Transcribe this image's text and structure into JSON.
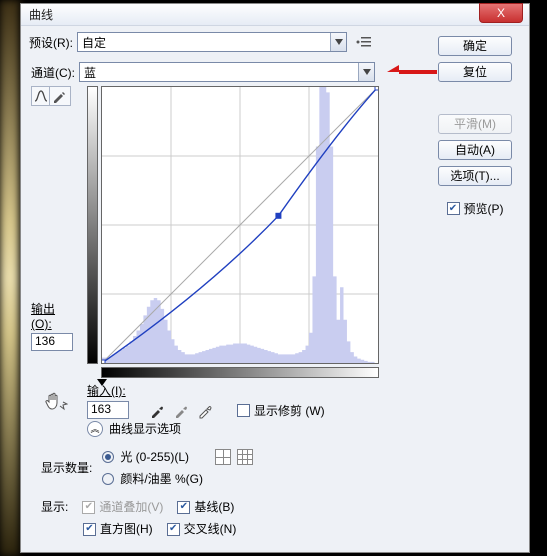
{
  "window": {
    "title": "曲线"
  },
  "preset": {
    "label": "预设(R):",
    "value": "自定"
  },
  "buttons": {
    "ok": "确定",
    "reset": "复位",
    "smooth": "平滑(M)",
    "auto": "自动(A)",
    "options": "选项(T)..."
  },
  "preview": {
    "label": "预览(P)",
    "checked": true
  },
  "channel": {
    "label": "通道(C):",
    "value": "蓝"
  },
  "output": {
    "label": "输出(O):",
    "value": "136"
  },
  "input": {
    "label": "输入(I):",
    "value": "163"
  },
  "showclip": {
    "label": "显示修剪 (W)",
    "checked": false
  },
  "expander": {
    "label": "曲线显示选项"
  },
  "amount": {
    "label": "显示数量:",
    "opt_light": "光 (0-255)(L)",
    "opt_ink": "颜料/油墨 %(G)",
    "selected": "light"
  },
  "show": {
    "label": "显示:",
    "overlay": "通道叠加(V)",
    "baseline": "基线(B)",
    "histogram": "直方图(H)",
    "intersection": "交叉线(N)"
  },
  "icons": {
    "close": "X",
    "curve_tool": "∿",
    "pencil_tool": "✎",
    "hand": "☟",
    "eyedrop": "✎"
  },
  "chart_data": {
    "type": "line",
    "title": "",
    "xlabel": "输入",
    "ylabel": "输出",
    "xlim": [
      0,
      255
    ],
    "ylim": [
      0,
      255
    ],
    "series": [
      {
        "name": "curve",
        "points": [
          [
            0,
            0
          ],
          [
            163,
            136
          ],
          [
            255,
            255
          ]
        ]
      },
      {
        "name": "baseline",
        "points": [
          [
            0,
            0
          ],
          [
            255,
            255
          ]
        ]
      }
    ],
    "active_point": [
      163,
      136
    ],
    "histogram": [
      5,
      5,
      6,
      8,
      10,
      12,
      14,
      16,
      20,
      25,
      30,
      36,
      44,
      52,
      58,
      60,
      58,
      50,
      40,
      30,
      22,
      16,
      12,
      10,
      8,
      8,
      8,
      9,
      10,
      11,
      12,
      13,
      14,
      15,
      16,
      16,
      17,
      17,
      18,
      18,
      18,
      18,
      17,
      16,
      15,
      14,
      13,
      12,
      11,
      10,
      9,
      8,
      8,
      8,
      8,
      8,
      9,
      10,
      12,
      16,
      28,
      80,
      200,
      255,
      255,
      250,
      200,
      80,
      40,
      70,
      40,
      20,
      10,
      6,
      4,
      3,
      2,
      1,
      1,
      0
    ]
  }
}
